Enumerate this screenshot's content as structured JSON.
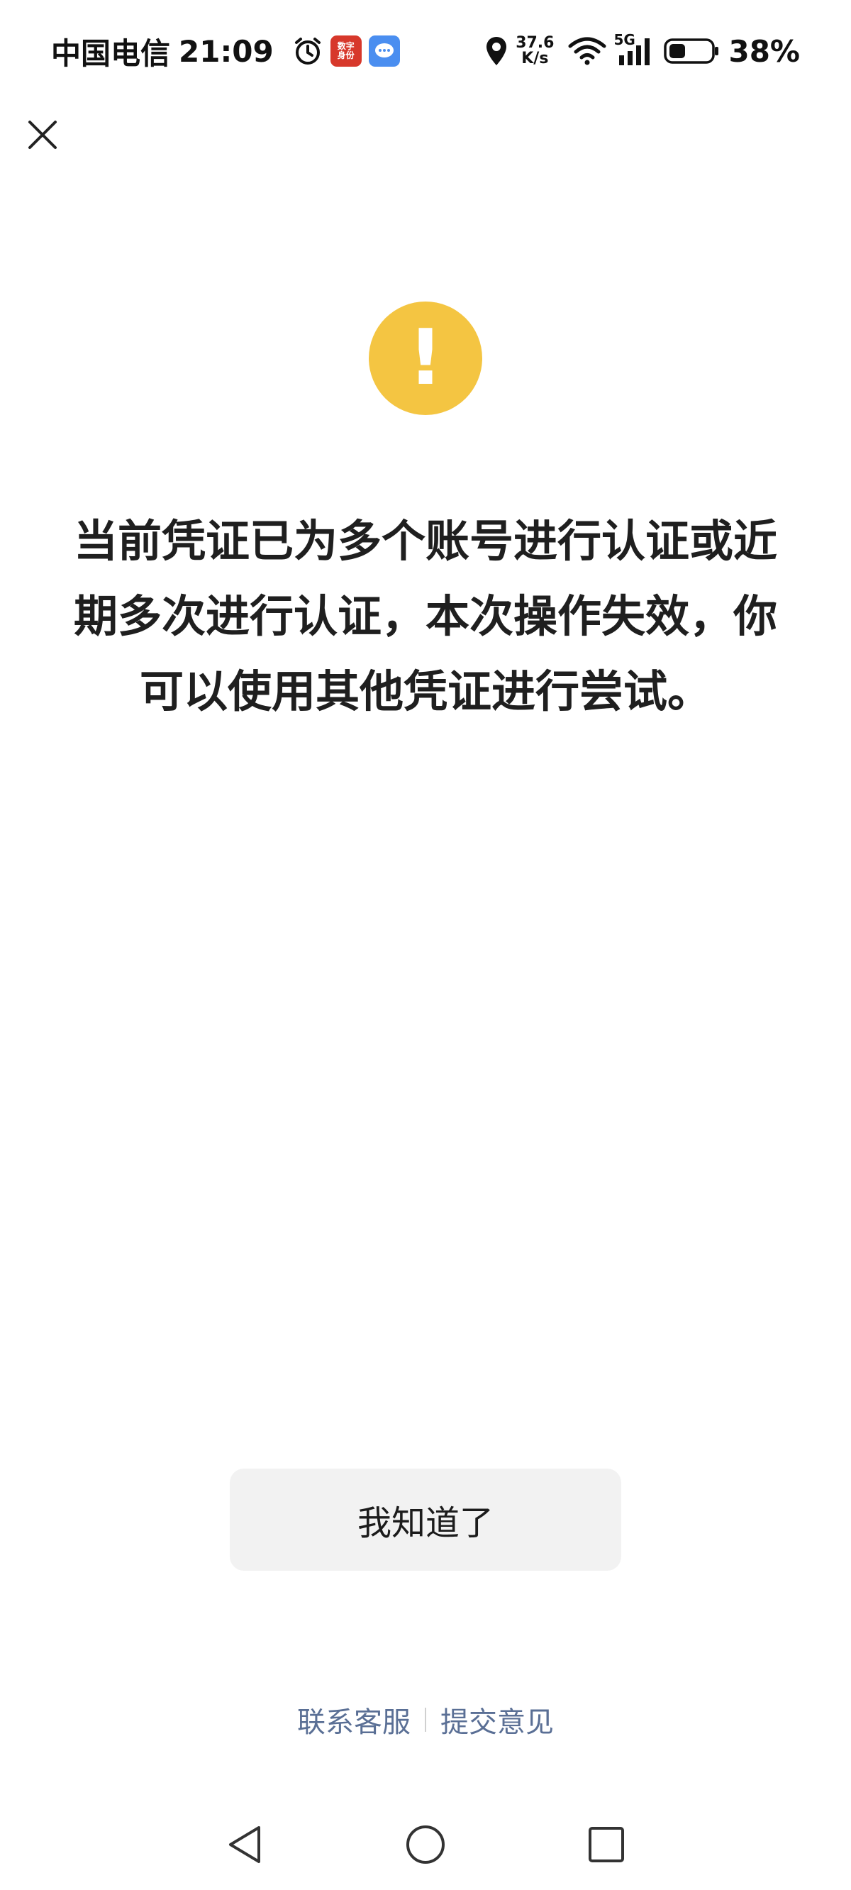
{
  "status_bar": {
    "carrier": "中国电信",
    "time": "21:09",
    "app_badge_red_text": "数字身份",
    "net_speed_value": "37.6",
    "net_speed_unit": "K/s",
    "network_type": "5G",
    "battery_percent": "38%"
  },
  "dialog": {
    "icon": "warning-icon",
    "icon_color": "#f4c542",
    "icon_glyph": "!",
    "message": "当前凭证已为多个账号进行认证或近期多次进行认证，本次操作失效，你可以使用其他凭证进行尝试。",
    "confirm_button": "我知道了"
  },
  "footer": {
    "contact_support": "联系客服",
    "submit_feedback": "提交意见",
    "link_color": "#5a6f95"
  },
  "nav_bar": {
    "icons": [
      "back-triangle-icon",
      "home-circle-icon",
      "recents-square-icon"
    ]
  }
}
